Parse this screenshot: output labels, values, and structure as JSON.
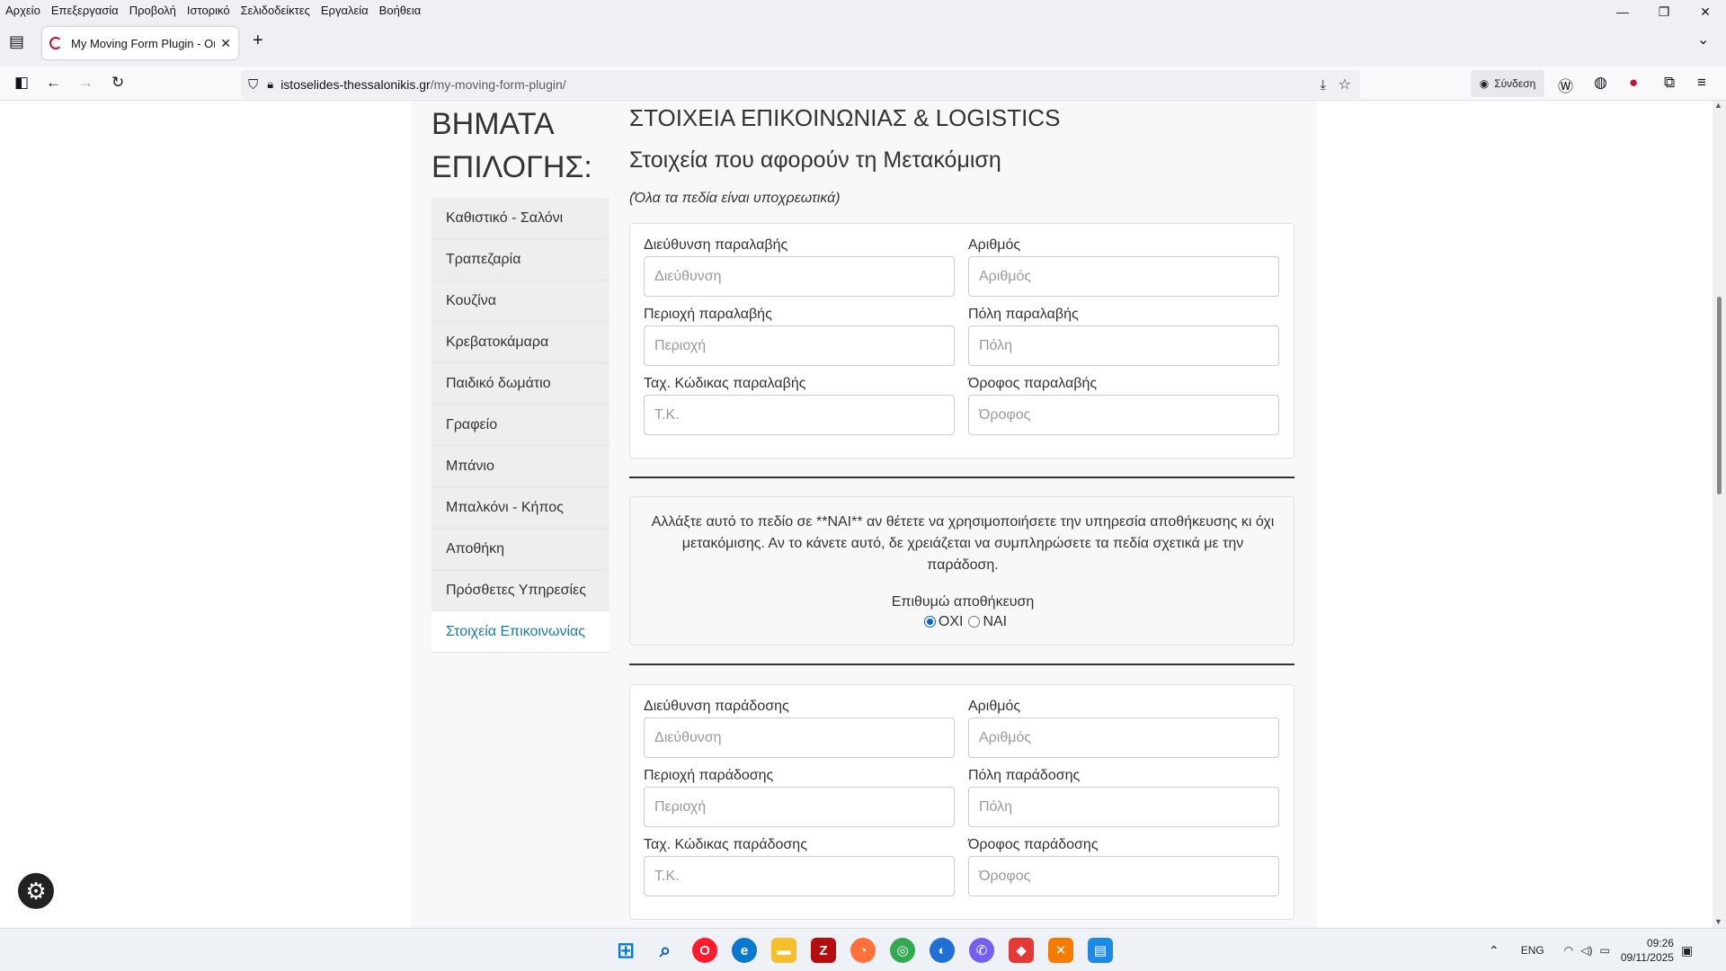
{
  "menu": [
    "Αρχείο",
    "Επεξεργασία",
    "Προβολή",
    "Ιστορικό",
    "Σελιδοδείκτες",
    "Εργαλεία",
    "Βοήθεια"
  ],
  "tab": {
    "title": "My Moving Form Plugin - Οικια"
  },
  "url": {
    "host": "istoselides-thessalonikis.gr",
    "path": "/my-moving-form-plugin/"
  },
  "signin": "Σύνδεση",
  "steps": {
    "title_line1": "ΒΗΜΑΤΑ",
    "title_line2": "ΕΠΙΛΟΓΗΣ:",
    "items": [
      "Καθιστικό - Σαλόνι",
      "Τραπεζαρία",
      "Κουζίνα",
      "Κρεβατοκάμαρα",
      "Παιδικό δωμάτιο",
      "Γραφείο",
      "Μπάνιο",
      "Μπαλκόνι - Κήπος",
      "Αποθήκη",
      "Πρόσθετες Υπηρεσίες",
      "Στοιχεία Επικοινωνίας"
    ],
    "active_index": 10
  },
  "form": {
    "heading": "ΣΤΟΙΧΕΙΑ ΕΠΙΚΟΙΝΩΝΙΑΣ & LOGISTICS",
    "subheading": "Στοιχεία που αφορούν τη Μετακόμιση",
    "note": "(Όλα τα πεδία είναι υποχρεωτικά)",
    "pickup": {
      "address_label": "Διεύθυνση παραλαβής",
      "address_ph": "Διεύθυνση",
      "number_label": "Αριθμός",
      "number_ph": "Αριθμός",
      "area_label": "Περιοχή παραλαβής",
      "area_ph": "Περιοχή",
      "city_label": "Πόλη παραλαβής",
      "city_ph": "Πόλη",
      "zip_label": "Ταχ. Κώδικας παραλαβής",
      "zip_ph": "Τ.Κ.",
      "floor_label": "Όροφος παραλαβής",
      "floor_ph": "Όροφος"
    },
    "storage": {
      "info": "Αλλάξτε αυτό το πεδίο σε **ΝΑΙ** αν θέτετε να χρησιμοποιήσετε την υπηρεσία αποθήκευσης κι όχι μετακόμισης. Αν το κάνετε αυτό, δε χρειάζεται να συμπληρώσετε τα πεδία σχετικά με την παράδοση.",
      "label": "Επιθυμώ αποθήκευση",
      "no": "ΟΧΙ",
      "yes": "ΝΑΙ",
      "selected": "ΟΧΙ"
    },
    "delivery": {
      "address_label": "Διεύθυνση παράδοσης",
      "address_ph": "Διεύθυνση",
      "number_label": "Αριθμός",
      "number_ph": "Αριθμός",
      "area_label": "Περιοχή παράδοσης",
      "area_ph": "Περιοχή",
      "city_label": "Πόλη παράδοσης",
      "city_ph": "Πόλη",
      "zip_label": "Ταχ. Κώδικας παράδοσης",
      "zip_ph": "Τ.Κ.",
      "floor_label": "Όροφος παράδοσης",
      "floor_ph": "Όροφος"
    }
  },
  "tray": {
    "lang": "ENG",
    "time": "09:26",
    "date": "09/11/2025"
  }
}
